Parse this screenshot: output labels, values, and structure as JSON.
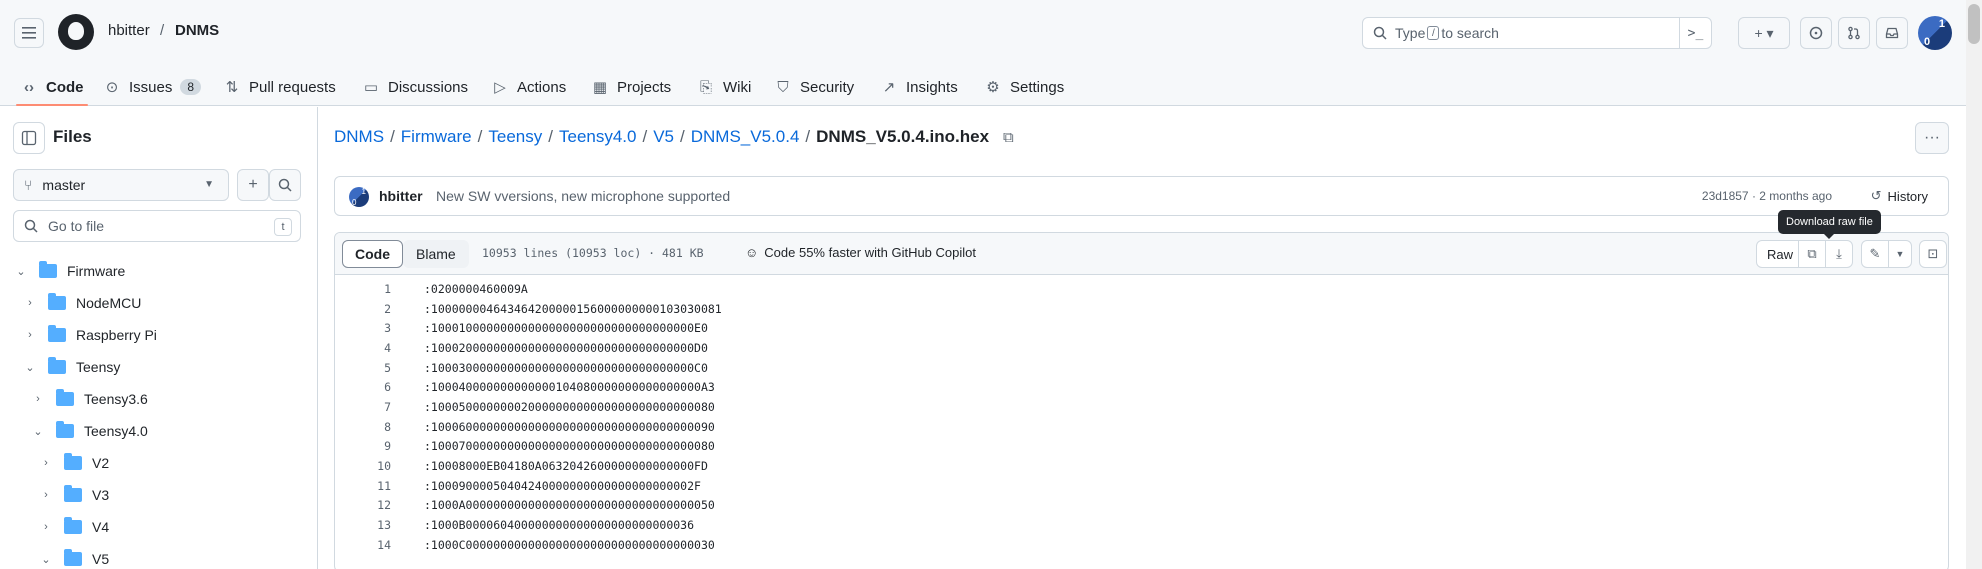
{
  "header": {
    "owner": "hbitter",
    "separator": "/",
    "repo": "DNMS",
    "search_prefix": "Type",
    "search_key": "/",
    "search_suffix": "to search",
    "command_symbol": ">_",
    "plus_label": "+ ▾",
    "avatar_top": "1",
    "avatar_bottom": "0"
  },
  "tabs": [
    {
      "label": "Code",
      "icon": "code-icon"
    },
    {
      "label": "Issues",
      "icon": "issue-icon",
      "count": "8"
    },
    {
      "label": "Pull requests",
      "icon": "pull-request-icon"
    },
    {
      "label": "Discussions",
      "icon": "discussion-icon"
    },
    {
      "label": "Actions",
      "icon": "play-icon"
    },
    {
      "label": "Projects",
      "icon": "table-icon"
    },
    {
      "label": "Wiki",
      "icon": "book-icon"
    },
    {
      "label": "Security",
      "icon": "shield-icon"
    },
    {
      "label": "Insights",
      "icon": "graph-icon"
    },
    {
      "label": "Settings",
      "icon": "gear-icon"
    }
  ],
  "sidebar": {
    "title": "Files",
    "branch": "master",
    "goto_placeholder": "Go to file",
    "goto_key": "t",
    "tree": [
      {
        "label": "Firmware",
        "expanded": true
      },
      {
        "label": "NodeMCU",
        "expanded": false
      },
      {
        "label": "Raspberry Pi",
        "expanded": false
      },
      {
        "label": "Teensy",
        "expanded": true
      },
      {
        "label": "Teensy3.6",
        "expanded": false
      },
      {
        "label": "Teensy4.0",
        "expanded": true
      },
      {
        "label": "V2",
        "expanded": false
      },
      {
        "label": "V3",
        "expanded": false
      },
      {
        "label": "V4",
        "expanded": false
      },
      {
        "label": "V5",
        "expanded": true
      }
    ]
  },
  "breadcrumb": {
    "parts": [
      "DNMS",
      "Firmware",
      "Teensy",
      "Teensy4.0",
      "V5",
      "DNMS_V5.0.4"
    ],
    "current": "DNMS_V5.0.4.ino.hex"
  },
  "commit": {
    "author": "hbitter",
    "message": "New SW vversions, new microphone supported",
    "meta": "23d1857 · 2 months ago",
    "history_label": "History",
    "avatar_top": "1",
    "avatar_bottom": "0"
  },
  "file": {
    "code_tab": "Code",
    "blame_tab": "Blame",
    "info": "10953 lines (10953 loc) · 481 KB",
    "copilot": "Code 55% faster with GitHub Copilot",
    "raw_label": "Raw",
    "tooltip": "Download raw file",
    "lines": [
      ":0200000460009A",
      ":100000004643464200000156000000000103030081",
      ":10001000000000000000000000000000000000E0",
      ":10002000000000000000000000000000000000D0",
      ":10003000000000000000000000000000000000C0",
      ":100040000000000000104080000000000000000A3",
      ":10005000000002000000000000000000000000080",
      ":10006000000000000000000000000000000000090",
      ":10007000000000000000000000000000000000080",
      ":10008000EB04180A0632042600000000000000FD",
      ":10009000050404240000000000000000000002F",
      ":1000A000000000000000000000000000000000050",
      ":1000B000060400000000000000000000000036",
      ":1000C000000000000000000000000000000000030"
    ]
  }
}
